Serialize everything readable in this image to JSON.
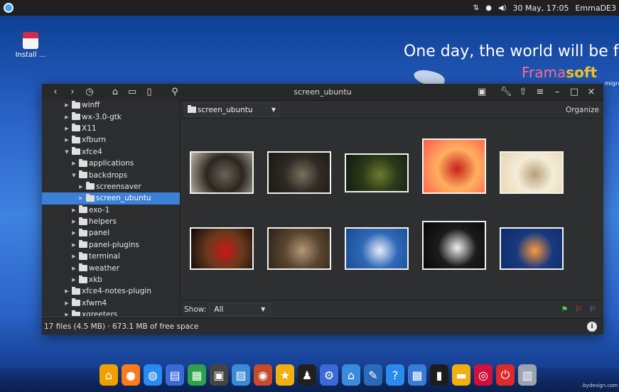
{
  "top_panel": {
    "icons": [
      "network-icon",
      "circle-icon",
      "volume-icon"
    ],
    "clock": "30 May, 17:05",
    "user": "EmmaDE3"
  },
  "desktop": {
    "icon_label": "Install ...",
    "tagline": "One day, the world will be fr",
    "brand_part1": "Frama",
    "brand_part2": "soft",
    "side_text": "migrat"
  },
  "window": {
    "title": "screen_ubuntu",
    "tree": [
      {
        "label": "winff",
        "indent": 1,
        "expanded": false,
        "selected": false
      },
      {
        "label": "wx-3.0-gtk",
        "indent": 1,
        "expanded": false,
        "selected": false
      },
      {
        "label": "X11",
        "indent": 1,
        "expanded": false,
        "selected": false
      },
      {
        "label": "xfburn",
        "indent": 1,
        "expanded": false,
        "selected": false
      },
      {
        "label": "xfce4",
        "indent": 1,
        "expanded": true,
        "selected": false
      },
      {
        "label": "applications",
        "indent": 2,
        "expanded": false,
        "selected": false
      },
      {
        "label": "backdrops",
        "indent": 2,
        "expanded": true,
        "selected": false
      },
      {
        "label": "screensaver",
        "indent": 3,
        "expanded": false,
        "selected": false
      },
      {
        "label": "screen_ubuntu",
        "indent": 3,
        "expanded": false,
        "selected": true
      },
      {
        "label": "exo-1",
        "indent": 2,
        "expanded": false,
        "selected": false
      },
      {
        "label": "helpers",
        "indent": 2,
        "expanded": false,
        "selected": false
      },
      {
        "label": "panel",
        "indent": 2,
        "expanded": false,
        "selected": false
      },
      {
        "label": "panel-plugins",
        "indent": 2,
        "expanded": false,
        "selected": false
      },
      {
        "label": "terminal",
        "indent": 2,
        "expanded": false,
        "selected": false
      },
      {
        "label": "weather",
        "indent": 2,
        "expanded": false,
        "selected": false
      },
      {
        "label": "xkb",
        "indent": 2,
        "expanded": false,
        "selected": false
      },
      {
        "label": "xfce4-notes-plugin",
        "indent": 1,
        "expanded": false,
        "selected": false
      },
      {
        "label": "xfwm4",
        "indent": 1,
        "expanded": false,
        "selected": false
      },
      {
        "label": "xgreeters",
        "indent": 1,
        "expanded": false,
        "selected": false
      }
    ],
    "path_combo": "screen_ubuntu",
    "organize": "Organize",
    "show_label": "Show:",
    "show_value": "All",
    "status": "17 files (4.5 MB)  ·  673.1 MB of free space",
    "info": "i",
    "thumbnails": [
      {
        "name": "thumb-snail",
        "colors": [
          "#bfb8a8",
          "#6a6456",
          "#2a2620"
        ]
      },
      {
        "name": "thumb-dark-sky",
        "colors": [
          "#1a1816",
          "#7a7060",
          "#2e2a24"
        ]
      },
      {
        "name": "thumb-tree-branches",
        "colors": [
          "#0f1a10",
          "#6d7a30",
          "#2c3a18"
        ]
      },
      {
        "name": "thumb-red-droplets",
        "colors": [
          "#ff5a4a",
          "#c8201a",
          "#ffb060"
        ]
      },
      {
        "name": "thumb-bee-flower",
        "colors": [
          "#e8d6b0",
          "#b8a078",
          "#f4ecd8"
        ]
      },
      {
        "name": "thumb-cherries",
        "colors": [
          "#0a0808",
          "#c81818",
          "#6a3a1c"
        ]
      },
      {
        "name": "thumb-leaf",
        "colors": [
          "#2a2218",
          "#b49878",
          "#5a4630"
        ]
      },
      {
        "name": "thumb-dandelion",
        "colors": [
          "#1a4a90",
          "#e8eef8",
          "#2e68b8"
        ]
      },
      {
        "name": "thumb-white-flower",
        "colors": [
          "#050505",
          "#f0f0f0",
          "#1c1c1c"
        ]
      },
      {
        "name": "thumb-pier-sunset",
        "colors": [
          "#0a2a6a",
          "#ff9a3a",
          "#1a3a80"
        ]
      }
    ],
    "flag_colors": [
      "#4cd64c",
      "#ff4a4a",
      "#5aa0ff"
    ]
  },
  "dock": {
    "items": [
      {
        "icon": "home-icon",
        "color": "#f2a000",
        "glyph": "⌂"
      },
      {
        "icon": "firefox-icon",
        "color": "#ff7a18",
        "glyph": "●"
      },
      {
        "icon": "globe-icon",
        "color": "#2a8af0",
        "glyph": "◍"
      },
      {
        "icon": "document-icon",
        "color": "#3a6ad8",
        "glyph": "▤"
      },
      {
        "icon": "spreadsheet-icon",
        "color": "#2ea04a",
        "glyph": "▦"
      },
      {
        "icon": "film-icon",
        "color": "#444444",
        "glyph": "▣"
      },
      {
        "icon": "photos-icon",
        "color": "#3a8ad8",
        "glyph": "▨"
      },
      {
        "icon": "music-icon",
        "color": "#c84a2a",
        "glyph": "◉"
      },
      {
        "icon": "star-icon",
        "color": "#f2b010",
        "glyph": "★"
      },
      {
        "icon": "linux-tux-icon",
        "color": "#202020",
        "glyph": "♟"
      },
      {
        "icon": "settings-icon",
        "color": "#3a6ad8",
        "glyph": "⚙"
      },
      {
        "icon": "house-blue-icon",
        "color": "#3a8ae0",
        "glyph": "⌂"
      },
      {
        "icon": "tools-icon",
        "color": "#2a6ab8",
        "glyph": "✎"
      },
      {
        "icon": "help-icon",
        "color": "#2a8af0",
        "glyph": "?"
      },
      {
        "icon": "workspaces-icon",
        "color": "#3a7ad8",
        "glyph": "▩"
      },
      {
        "icon": "terminal-icon",
        "color": "#1c1c1c",
        "glyph": "▮"
      },
      {
        "icon": "notes-icon",
        "color": "#f2b010",
        "glyph": "▬"
      },
      {
        "icon": "debian-icon",
        "color": "#d0103a",
        "glyph": "◎"
      },
      {
        "icon": "power-icon",
        "color": "#e02a2a",
        "glyph": "⏻"
      },
      {
        "icon": "trash-icon",
        "color": "#9aa4b0",
        "glyph": "▥"
      }
    ],
    "credit": ":bydesign.com"
  }
}
